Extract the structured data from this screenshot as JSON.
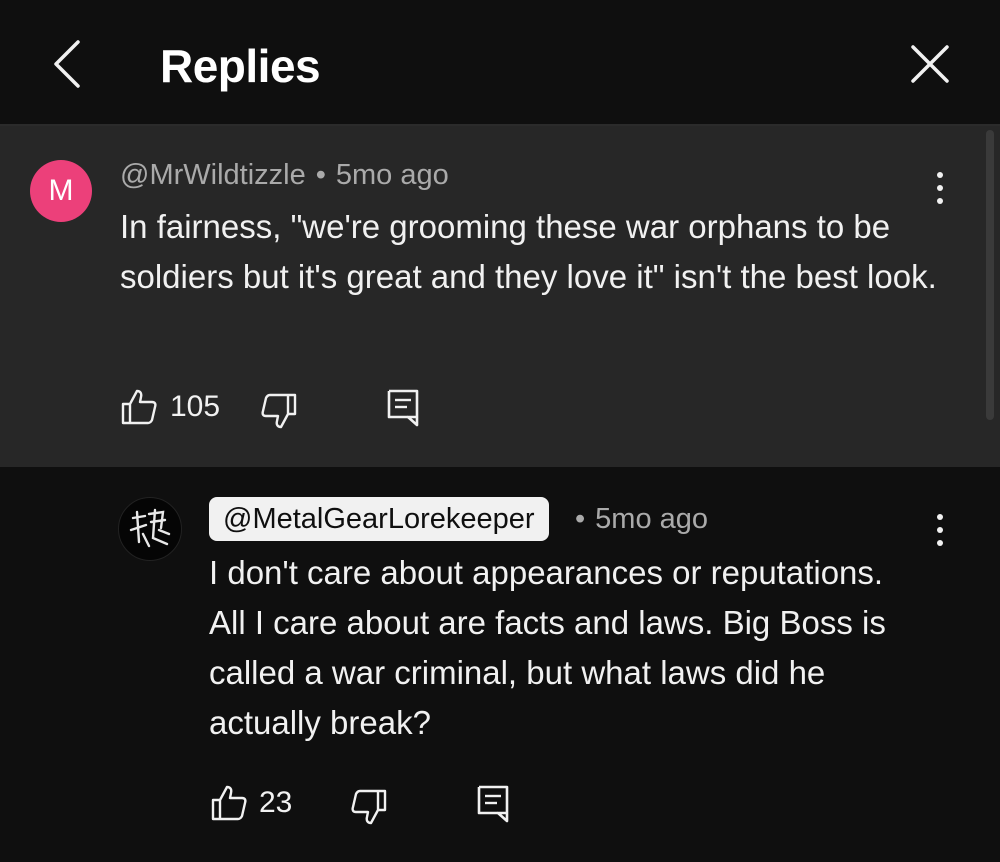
{
  "header": {
    "title": "Replies"
  },
  "parent_comment": {
    "avatar_letter": "M",
    "avatar_color": "#ec407a",
    "author": "@MrWildtizzle",
    "separator": "•",
    "time": "5mo ago",
    "text": "In fairness, \"we're grooming these war orphans to be soldiers but it's great and they love it\" isn't the best look.",
    "likes": "105"
  },
  "reply": {
    "author": "@MetalGearLorekeeper",
    "separator": "•",
    "time": "5mo ago",
    "text": "I don't care about appearances or reputations. All I care about are facts and laws. Big Boss is called a war criminal, but what laws did he actually break?",
    "likes": "23"
  },
  "icons": {
    "back": "chevron-left-icon",
    "close": "close-icon",
    "like": "thumbs-up-icon",
    "dislike": "thumbs-down-icon",
    "reply": "comment-icon",
    "more": "more-vertical-icon"
  }
}
